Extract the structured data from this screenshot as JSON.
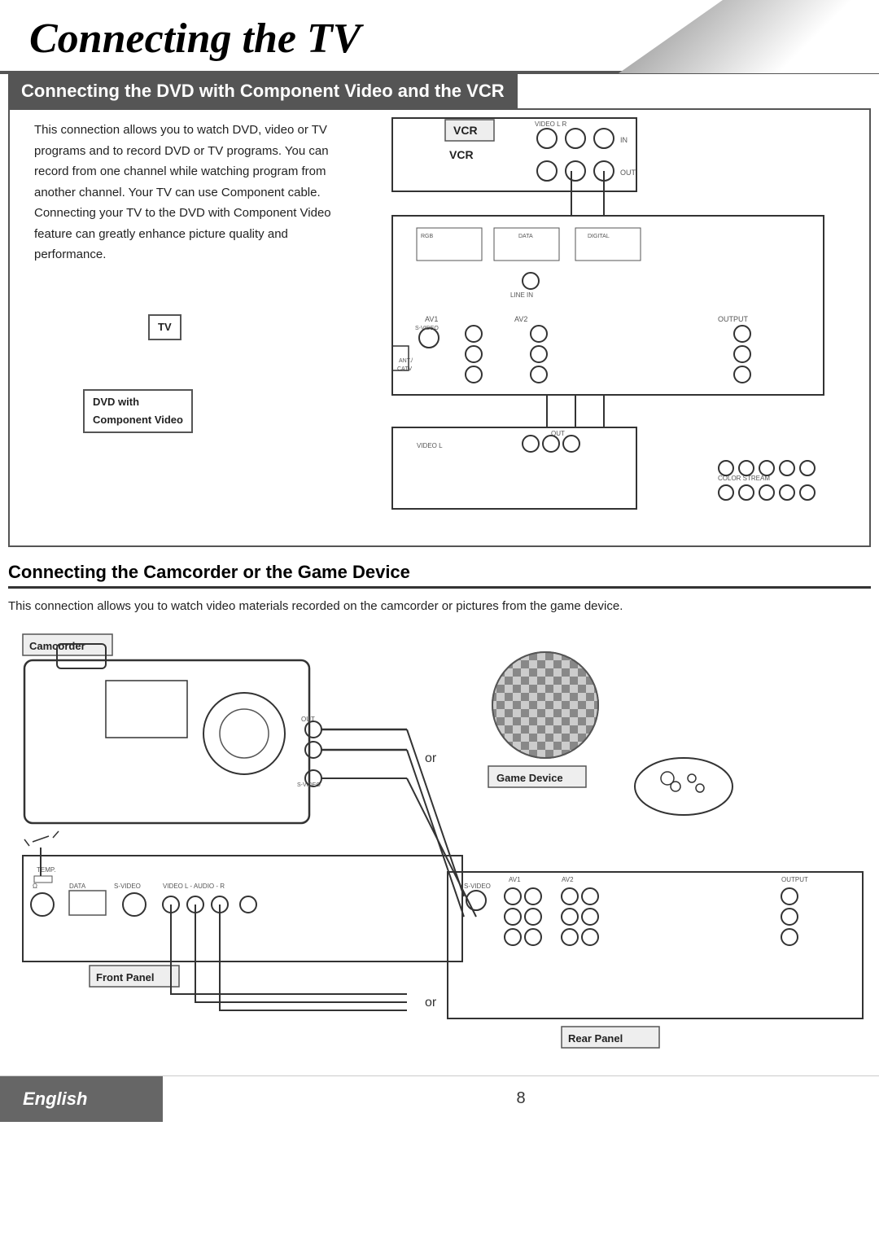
{
  "page": {
    "title": "Connecting the TV",
    "section1": {
      "heading": "Connecting the DVD with Component Video and the VCR",
      "body": "This connection allows you to watch DVD, video or TV programs and to record DVD or TV programs. You can record from one channel while watching program from another channel. Your TV can use Component cable. Connecting your TV to the DVD with Component Video feature can greatly enhance picture quality and performance.",
      "labels": {
        "vcr": "VCR",
        "tv": "TV",
        "dvd": "DVD with\nComponent Video"
      }
    },
    "section2": {
      "heading": "Connecting the Camcorder or the Game Device",
      "body": "This connection allows you to watch video materials recorded on the camcorder or pictures from the game device.",
      "labels": {
        "camcorder": "Camcorder",
        "game_device": "Game Device",
        "front_panel": "Front Panel",
        "rear_panel": "Rear Panel",
        "or1": "or",
        "or2": "or"
      }
    },
    "footer": {
      "language": "English",
      "page_number": "8"
    }
  }
}
